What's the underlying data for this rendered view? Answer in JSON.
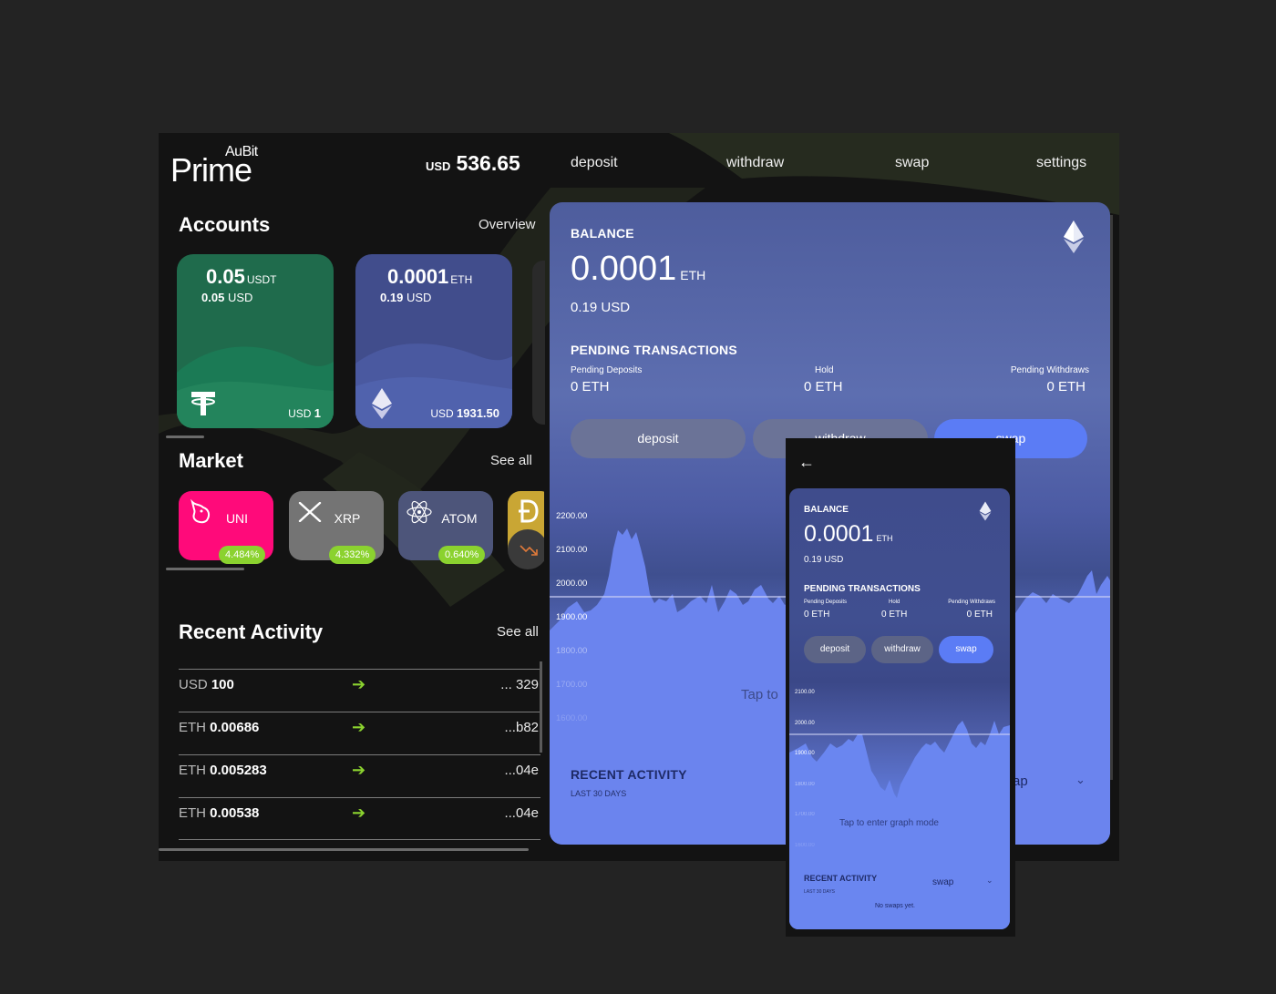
{
  "brand": {
    "small": "AuBit",
    "big": "Prime"
  },
  "header": {
    "total_currency": "USD",
    "total_amount": "536.65",
    "nav": [
      "deposit",
      "withdraw",
      "swap",
      "settings"
    ]
  },
  "accounts": {
    "title": "Accounts",
    "link": "Overview",
    "cards": [
      {
        "amount": "0.05",
        "symbol": "USDT",
        "usd": "0.05",
        "usd_unit": "USD",
        "foot_cur": "USD",
        "foot_val": "1",
        "color": "#1f6b4c",
        "icon": "tether-icon"
      },
      {
        "amount": "0.0001",
        "symbol": "ETH",
        "usd": "0.19",
        "usd_unit": "USD",
        "foot_cur": "USD",
        "foot_val": "1931.50",
        "color": "#414d8c",
        "icon": "ethereum-icon"
      }
    ]
  },
  "market": {
    "title": "Market",
    "link": "See all",
    "coins": [
      {
        "name": "UNI",
        "change": "4.484%",
        "color": "#ff0a7a",
        "icon": "unicorn-icon"
      },
      {
        "name": "XRP",
        "change": "4.332%",
        "color": "#747474",
        "icon": "xrp-icon"
      },
      {
        "name": "ATOM",
        "change": "0.640%",
        "color": "#4d557a",
        "icon": "atom-icon"
      }
    ]
  },
  "activity": {
    "title": "Recent Activity",
    "link": "See all",
    "rows": [
      {
        "currency": "USD",
        "amount": "100",
        "address": "... 329"
      },
      {
        "currency": "ETH",
        "amount": "0.00686",
        "address": "...b82"
      },
      {
        "currency": "ETH",
        "amount": "0.005283",
        "address": "...04e"
      },
      {
        "currency": "ETH",
        "amount": "0.00538",
        "address": "...04e"
      }
    ]
  },
  "balance_panel": {
    "label": "BALANCE",
    "amount": "0.0001",
    "symbol": "ETH",
    "usd": "0.19 USD",
    "pending_title": "PENDING TRANSACTIONS",
    "pending": [
      {
        "label": "Pending Deposits",
        "value": "0 ETH"
      },
      {
        "label": "Hold",
        "value": "0 ETH"
      },
      {
        "label": "Pending Withdraws",
        "value": "0 ETH"
      }
    ],
    "buttons": [
      "deposit",
      "withdraw",
      "swap"
    ],
    "y_ticks": [
      "2200.00",
      "2100.00",
      "2000.00",
      "1900.00",
      "1800.00",
      "1700.00",
      "1600.00"
    ],
    "tap_hint": "Tap to",
    "recent_title": "RECENT ACTIVITY",
    "recent_sub": "LAST 30 DAYS",
    "swap_partial": "ap"
  },
  "phone": {
    "label": "BALANCE",
    "amount": "0.0001",
    "symbol": "ETH",
    "usd": "0.19 USD",
    "pending_title": "PENDING TRANSACTIONS",
    "pending": [
      {
        "label": "Pending Deposits",
        "value": "0 ETH"
      },
      {
        "label": "Hold",
        "value": "0 ETH"
      },
      {
        "label": "Pending Withdraws",
        "value": "0 ETH"
      }
    ],
    "buttons": [
      "deposit",
      "withdraw",
      "swap"
    ],
    "y_ticks": [
      "2100.00",
      "2000.00",
      "1900.00",
      "1800.00",
      "1700.00",
      "1600.00"
    ],
    "tap_hint": "Tap to enter graph mode",
    "recent_title": "RECENT ACTIVITY",
    "recent_sub": "LAST 30 DAYS",
    "filter": "swap",
    "empty": "No swaps yet."
  },
  "colors": {
    "accent_green": "#8bd22f",
    "primary_blue": "#5b7cf5"
  }
}
